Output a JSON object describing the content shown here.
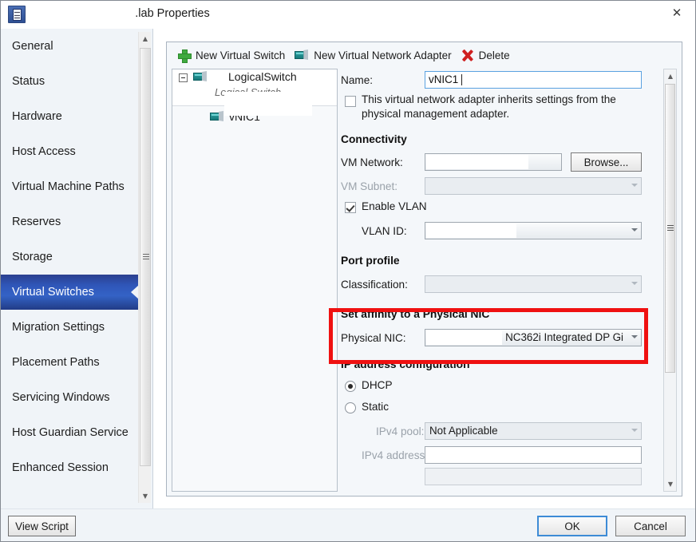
{
  "window": {
    "title": ".lab Properties",
    "icon": "properties-window-icon",
    "close_label": "✕"
  },
  "sidebar": {
    "items": [
      {
        "label": "General",
        "selected": false
      },
      {
        "label": "Status",
        "selected": false
      },
      {
        "label": "Hardware",
        "selected": false
      },
      {
        "label": "Host Access",
        "selected": false
      },
      {
        "label": "Virtual Machine Paths",
        "selected": false
      },
      {
        "label": "Reserves",
        "selected": false
      },
      {
        "label": "Storage",
        "selected": false
      },
      {
        "label": "Virtual Switches",
        "selected": true
      },
      {
        "label": "Migration Settings",
        "selected": false
      },
      {
        "label": "Placement Paths",
        "selected": false
      },
      {
        "label": "Servicing Windows",
        "selected": false
      },
      {
        "label": "Host Guardian Service",
        "selected": false
      },
      {
        "label": "Enhanced Session",
        "selected": false
      }
    ]
  },
  "toolbar": {
    "new_virtual_switch": "New Virtual Switch",
    "new_virtual_network_adapter": "New Virtual Network Adapter",
    "delete": "Delete"
  },
  "tree": {
    "root_label": "LogicalSwitch",
    "root_sublabel": "Logical Switch",
    "child_label": "vNIC1"
  },
  "form": {
    "name_label": "Name:",
    "name_value": "vNIC1",
    "inherit_checkbox_line1": "This virtual network adapter inherits settings from the",
    "inherit_checkbox_line2": "physical management adapter.",
    "inherit_checked": false,
    "connectivity_header": "Connectivity",
    "vm_network_label": "VM Network:",
    "vm_network_value": "",
    "browse_label": "Browse...",
    "vm_subnet_label": "VM Subnet:",
    "vm_subnet_value": "",
    "enable_vlan_label": "Enable VLAN",
    "enable_vlan_checked": true,
    "vlan_id_label": "VLAN ID:",
    "vlan_id_value": "",
    "port_profile_header": "Port profile",
    "classification_label": "Classification:",
    "classification_value": "",
    "affinity_header": "Set affinity to a Physical NIC",
    "physical_nic_label": "Physical NIC:",
    "physical_nic_value": "NC362i Integrated DP Gi",
    "ip_config_header": "IP address configuration",
    "dhcp_label": "DHCP",
    "dhcp_selected": true,
    "static_label": "Static",
    "static_selected": false,
    "ipv4_pool_label": "IPv4 pool:",
    "ipv4_pool_value": "Not Applicable",
    "ipv4_address_label": "IPv4 address:",
    "ipv4_address_value": ""
  },
  "footer": {
    "view_script": "View Script",
    "ok": "OK",
    "cancel": "Cancel"
  },
  "colors": {
    "highlight_box": "#ef1111",
    "selected_nav": "#2f56b8",
    "accent_blue": "#3d8bd6"
  }
}
